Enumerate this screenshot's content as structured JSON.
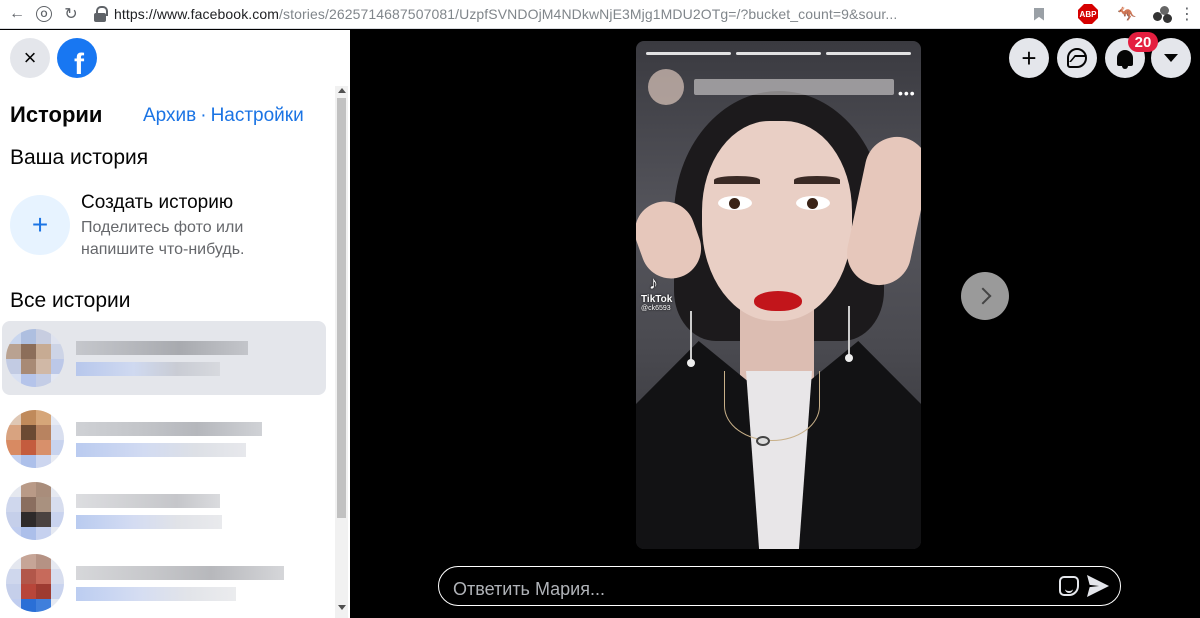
{
  "browser": {
    "url_host": "https://www.facebook.com",
    "url_path": "/stories/2625714687507081/UzpfSVNDOjM4NDkwNjE3Mjg1MDU2OTg=/?bucket_count=9&sour...",
    "extensions": [
      "bookmark-icon",
      "adblock-plus-icon",
      "kangaroo-icon",
      "extension-balls-icon"
    ],
    "abp_label": "ABP"
  },
  "sidebar": {
    "close_icon": "×",
    "logo_letter": "f",
    "title": "Истории",
    "archive_link": "Архив",
    "link_separator": "·",
    "settings_link": "Настройки",
    "your_story_heading": "Ваша история",
    "create": {
      "icon": "+",
      "title": "Создать историю",
      "subtitle": "Поделитесь фото или напишите что-нибудь."
    },
    "all_stories_heading": "Все истории"
  },
  "viewer": {
    "story_count_segments": 3,
    "watermark": {
      "logo": "♪",
      "brand": "TikTok",
      "handle": "@ck6593"
    },
    "more_icon": "•••",
    "top_actions": {
      "create_icon": "+",
      "notifications_badge": "20"
    },
    "reply": {
      "placeholder": "Ответить Мария..."
    }
  },
  "colors": {
    "facebook_blue": "#1877f2",
    "link_blue": "#1b74e4",
    "badge_red": "#e41e3f",
    "button_gray": "#e4e6eb"
  }
}
